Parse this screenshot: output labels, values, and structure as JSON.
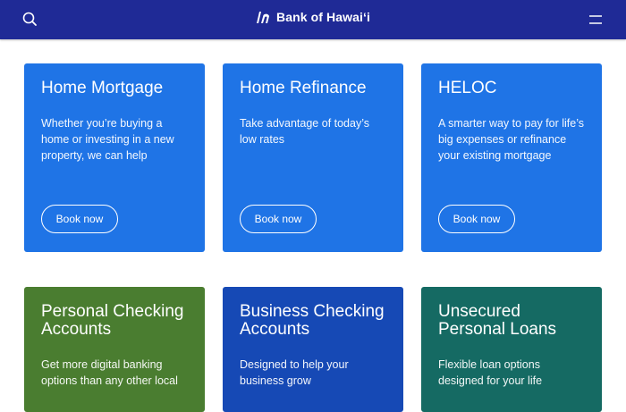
{
  "header": {
    "brand": "Bank of Hawaiʻi",
    "search_icon": "search-icon",
    "menu_icon": "hamburger-menu-icon",
    "logo_icon": "bank-logo-icon"
  },
  "colors": {
    "header": "#1f2a96",
    "card_blue": "#1f74e6",
    "card_green": "#4a7d30",
    "card_navy": "#1649b5",
    "card_teal": "#156a63"
  },
  "cards": [
    {
      "title": "Home Mortgage",
      "description": "Whether you’re buying a home or investing in a new property, we can help",
      "button": "Book now"
    },
    {
      "title": "Home Refinance",
      "description": "Take advantage of today’s low rates",
      "button": "Book now"
    },
    {
      "title": "HELOC",
      "description": "A smarter way to pay for life’s big expenses or refinance your existing mortgage",
      "button": "Book now"
    },
    {
      "title": "Personal Checking Accounts",
      "description": "Get more digital banking options than any other local"
    },
    {
      "title": "Business Checking Accounts",
      "description": "Designed to help your business grow"
    },
    {
      "title": "Unsecured Personal Loans",
      "description": "Flexible loan options designed for your life"
    }
  ]
}
